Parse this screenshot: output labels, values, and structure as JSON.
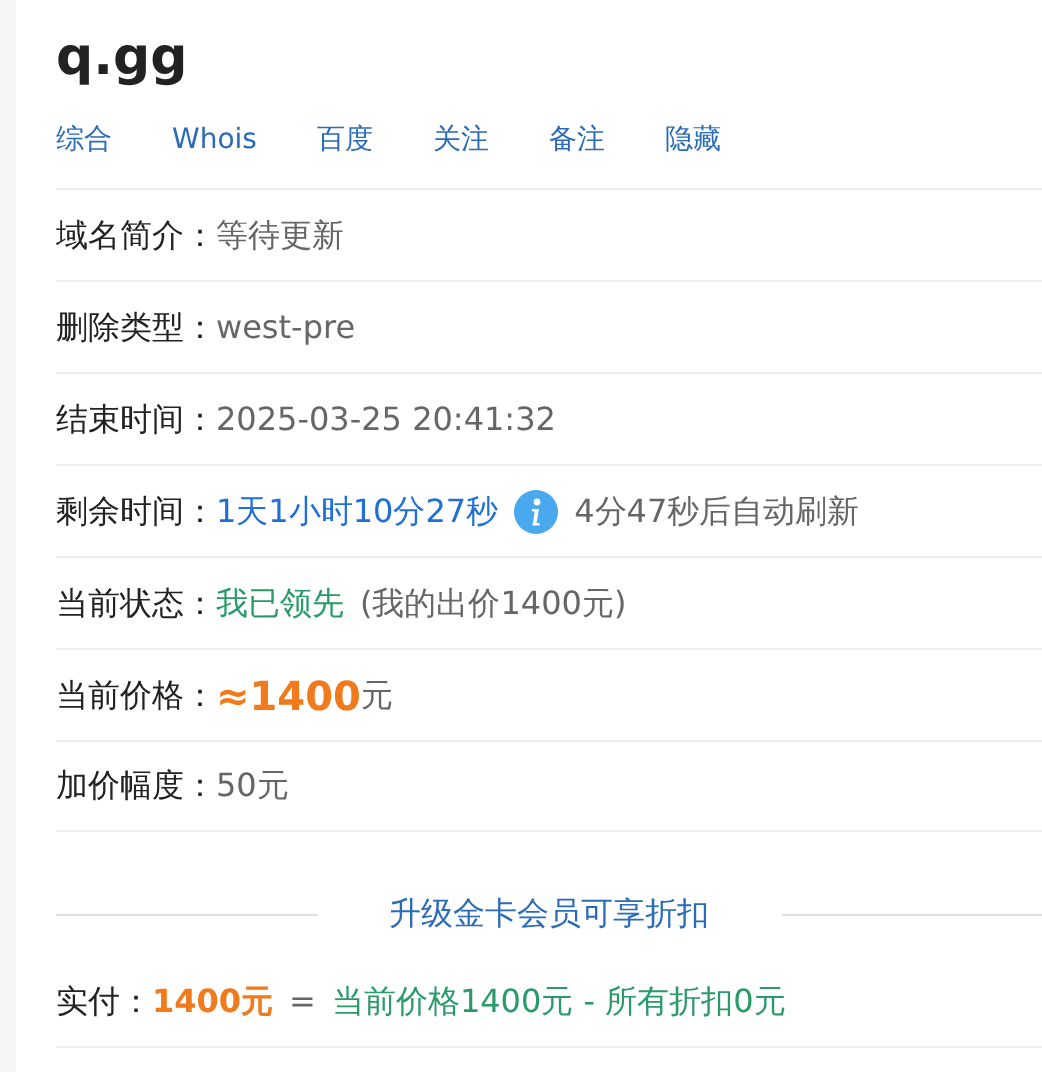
{
  "title": "q.gg",
  "links": [
    "综合",
    "Whois",
    "百度",
    "关注",
    "备注",
    "隐藏"
  ],
  "rows": [
    {
      "label": "域名简介：",
      "parts": [
        {
          "kind": "text",
          "text": "等待更新",
          "color": "#666666"
        }
      ]
    },
    {
      "label": "删除类型：",
      "parts": [
        {
          "kind": "text",
          "text": "west-pre",
          "color": "#666666"
        }
      ]
    },
    {
      "label": "结束时间：",
      "parts": [
        {
          "kind": "text",
          "text": "2025-03-25 20:41:32",
          "color": "#666666"
        }
      ]
    },
    {
      "label": "剩余时间：",
      "parts": [
        {
          "kind": "text",
          "text": "1天1小时10分27秒",
          "color": "#1f6fd6"
        },
        {
          "kind": "info-icon"
        },
        {
          "kind": "text",
          "text": "4分47秒后自动刷新",
          "color": "#666666"
        }
      ]
    },
    {
      "label": "当前状态：",
      "parts": [
        {
          "kind": "text",
          "text": "我已领先",
          "color": "#2a9a6a"
        },
        {
          "kind": "text",
          "text": "(我的出价1400元)",
          "color": "#666666"
        }
      ]
    },
    {
      "label": "当前价格：",
      "parts": [
        {
          "kind": "text",
          "text": "≈1400",
          "color": "#f07a1c",
          "bold": true,
          "large": true
        },
        {
          "kind": "text",
          "text": "元",
          "color": "#666666"
        }
      ]
    },
    {
      "label": "加价幅度：",
      "parts": [
        {
          "kind": "text",
          "text": "50元",
          "color": "#666666"
        }
      ]
    }
  ],
  "upgrade_link": "升级金卡会员可享折扣",
  "payment": {
    "label": "实付：",
    "parts": [
      {
        "kind": "text",
        "text": "1400元",
        "color": "#f07a1c",
        "bold": true
      },
      {
        "kind": "text",
        "text": "=",
        "color": "#666666"
      },
      {
        "kind": "text",
        "text": "当前价格1400元 - 所有折扣0元",
        "color": "#2a9a6a"
      }
    ]
  }
}
